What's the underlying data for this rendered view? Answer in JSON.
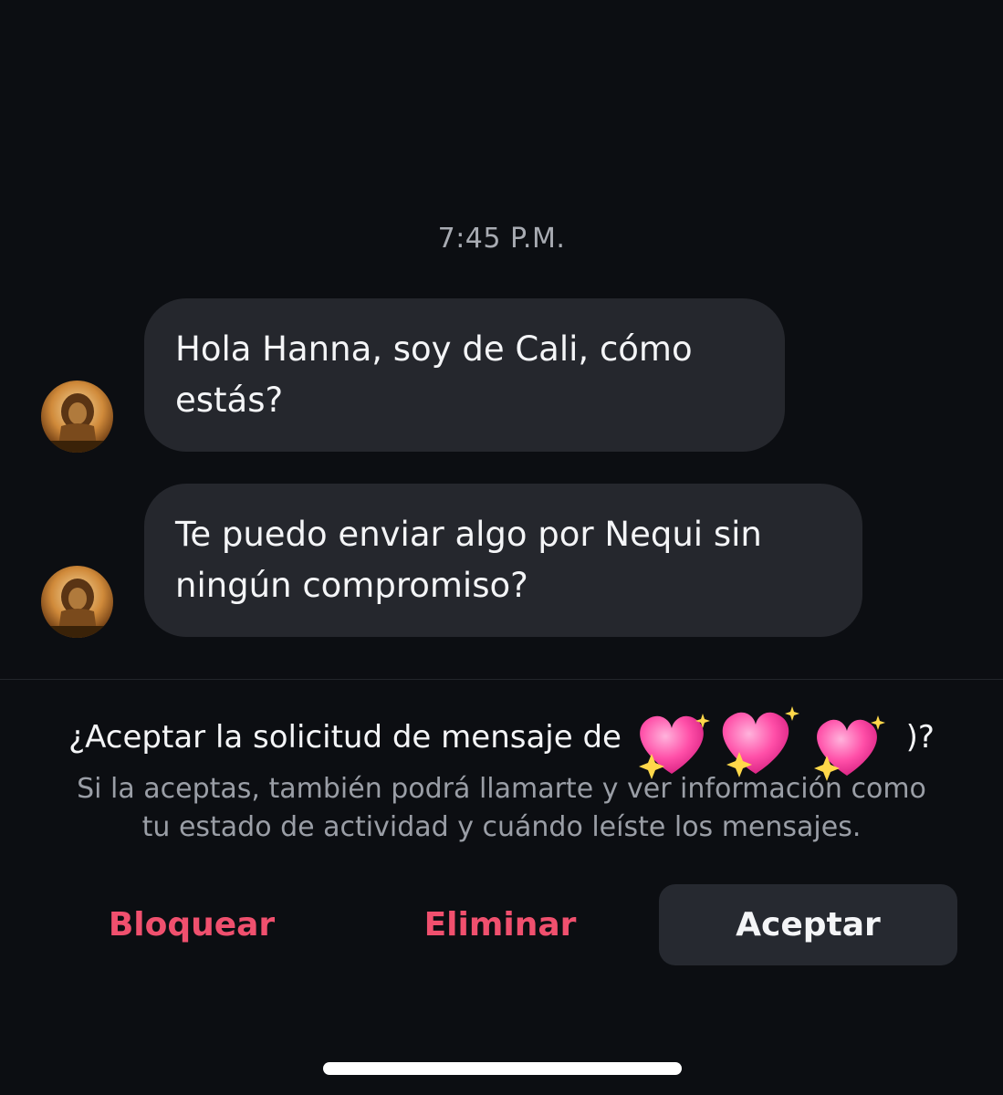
{
  "conversation": {
    "timestamp": "7:45 P.M.",
    "messages": [
      {
        "lines": [
          "Hola Hanna, soy de Cali, cómo",
          "estás?"
        ]
      },
      {
        "lines": [
          "Te puedo enviar algo por Nequi sin",
          "ningún compromiso?"
        ]
      }
    ]
  },
  "request": {
    "title_prefix": "¿Aceptar la solicitud de mensaje de",
    "title_suffix": ")?",
    "description_lines": [
      "Si la aceptas, también podrá llamarte y ver información como",
      "tu estado de actividad y cuándo leíste los mensajes."
    ]
  },
  "actions": {
    "block": "Bloquear",
    "delete": "Eliminar",
    "accept": "Aceptar"
  },
  "colors": {
    "background": "#0c0e12",
    "bubble": "#25272d",
    "danger": "#f0506e",
    "accept_bg": "#262930",
    "heart": "#ff4fa8"
  },
  "icons": {
    "avatar": "lion-avatar",
    "redaction": "sparkling-heart-emoji"
  }
}
